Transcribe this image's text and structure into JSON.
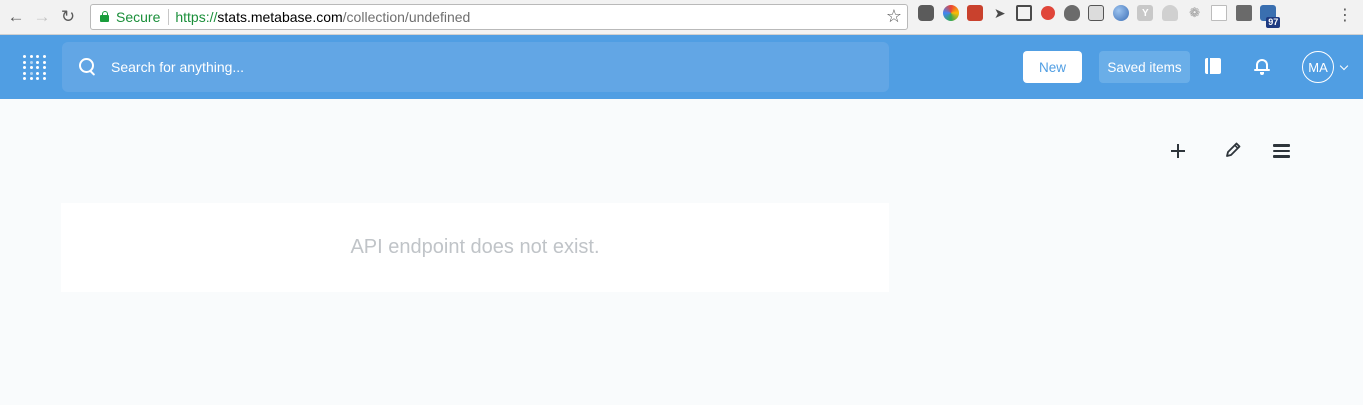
{
  "browser": {
    "secure_label": "Secure",
    "url_scheme": "https://",
    "url_host": "stats.metabase.com",
    "url_path": "/collection/undefined",
    "extension_badge": "97"
  },
  "header": {
    "search_placeholder": "Search for anything...",
    "new_label": "New",
    "saved_items_label": "Saved items",
    "avatar_initials": "MA"
  },
  "colors": {
    "brand": "#509ee3",
    "secure_green": "#1a8f3a",
    "error_text": "#c0c4c8"
  },
  "main": {
    "error_message": "API endpoint does not exist."
  }
}
